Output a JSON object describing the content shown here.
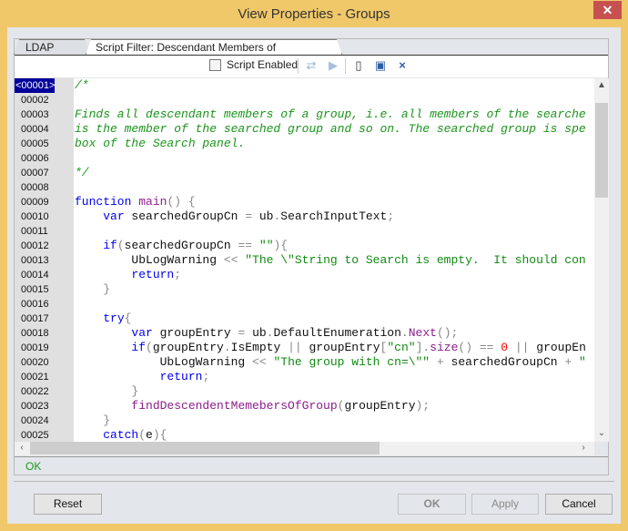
{
  "window": {
    "title": "View Properties - Groups",
    "close": "✕"
  },
  "tabs": [
    {
      "label": "LDAP Filter"
    },
    {
      "label": "Script Filter: Descendant Members of Group.script"
    }
  ],
  "toolbar": {
    "script_enabled_label": "Script Enabled",
    "script_enabled": false,
    "icons": [
      "refresh-icon",
      "run-icon",
      "new-document-icon",
      "save-icon",
      "close-icon"
    ]
  },
  "editor": {
    "current_line": "<00001>",
    "line_numbers": [
      "00002",
      "00003",
      "00004",
      "00005",
      "00006",
      "00007",
      "00008",
      "00009",
      "00010",
      "00011",
      "00012",
      "00013",
      "00014",
      "00015",
      "00016",
      "00017",
      "00018",
      "00019",
      "00020",
      "00021",
      "00022",
      "00023",
      "00024",
      "00025"
    ],
    "lines": [
      [
        [
          "c",
          "/*"
        ]
      ],
      [],
      [
        [
          "c",
          "Finds all descendant members of a group, i.e. all members of the searche"
        ]
      ],
      [
        [
          "c",
          "is the member of the searched group and so on. The searched group is spe"
        ]
      ],
      [
        [
          "c",
          "box of the Search panel."
        ]
      ],
      [],
      [
        [
          "c",
          "*/"
        ]
      ],
      [],
      [
        [
          "k",
          "function"
        ],
        [
          "t",
          " "
        ],
        [
          "f",
          "main"
        ],
        [
          "p",
          "() {"
        ]
      ],
      [
        [
          "t",
          "    "
        ],
        [
          "k",
          "var"
        ],
        [
          "t",
          " searchedGroupCn "
        ],
        [
          "p",
          "="
        ],
        [
          "t",
          " ub"
        ],
        [
          "p",
          "."
        ],
        [
          "t",
          "SearchInputText"
        ],
        [
          "p",
          ";"
        ]
      ],
      [],
      [
        [
          "t",
          "    "
        ],
        [
          "k",
          "if"
        ],
        [
          "p",
          "("
        ],
        [
          "t",
          "searchedGroupCn "
        ],
        [
          "p",
          "=="
        ],
        [
          "t",
          " "
        ],
        [
          "s",
          "\"\""
        ],
        [
          "p",
          "){"
        ]
      ],
      [
        [
          "t",
          "        UbLogWarning "
        ],
        [
          "p",
          "<<"
        ],
        [
          "t",
          " "
        ],
        [
          "s",
          "\"The \\\"String to Search is empty.  It should con"
        ]
      ],
      [
        [
          "t",
          "        "
        ],
        [
          "k",
          "return"
        ],
        [
          "p",
          ";"
        ]
      ],
      [
        [
          "t",
          "    "
        ],
        [
          "p",
          "}"
        ]
      ],
      [],
      [
        [
          "t",
          "    "
        ],
        [
          "k",
          "try"
        ],
        [
          "p",
          "{"
        ]
      ],
      [
        [
          "t",
          "        "
        ],
        [
          "k",
          "var"
        ],
        [
          "t",
          " groupEntry "
        ],
        [
          "p",
          "="
        ],
        [
          "t",
          " ub"
        ],
        [
          "p",
          "."
        ],
        [
          "t",
          "DefaultEnumeration"
        ],
        [
          "p",
          "."
        ],
        [
          "f",
          "Next"
        ],
        [
          "p",
          "();"
        ]
      ],
      [
        [
          "t",
          "        "
        ],
        [
          "k",
          "if"
        ],
        [
          "p",
          "("
        ],
        [
          "t",
          "groupEntry"
        ],
        [
          "p",
          "."
        ],
        [
          "t",
          "IsEmpty "
        ],
        [
          "p",
          "||"
        ],
        [
          "t",
          " groupEntry"
        ],
        [
          "p",
          "["
        ],
        [
          "s",
          "\"cn\""
        ],
        [
          "p",
          "]."
        ],
        [
          "f",
          "size"
        ],
        [
          "p",
          "()"
        ],
        [
          "t",
          " "
        ],
        [
          "p",
          "=="
        ],
        [
          "t",
          " "
        ],
        [
          "n",
          "0"
        ],
        [
          "t",
          " "
        ],
        [
          "p",
          "||"
        ],
        [
          "t",
          " groupEn"
        ]
      ],
      [
        [
          "t",
          "            UbLogWarning "
        ],
        [
          "p",
          "<<"
        ],
        [
          "t",
          " "
        ],
        [
          "s",
          "\"The group with cn=\\\"\""
        ],
        [
          "t",
          " "
        ],
        [
          "p",
          "+"
        ],
        [
          "t",
          " searchedGroupCn "
        ],
        [
          "p",
          "+"
        ],
        [
          "t",
          " "
        ],
        [
          "s",
          "\""
        ]
      ],
      [
        [
          "t",
          "            "
        ],
        [
          "k",
          "return"
        ],
        [
          "p",
          ";"
        ]
      ],
      [
        [
          "t",
          "        "
        ],
        [
          "p",
          "}"
        ]
      ],
      [
        [
          "t",
          "        "
        ],
        [
          "f",
          "findDescendentMemebersOfGroup"
        ],
        [
          "p",
          "("
        ],
        [
          "t",
          "groupEntry"
        ],
        [
          "p",
          ");"
        ]
      ],
      [
        [
          "t",
          "    "
        ],
        [
          "p",
          "}"
        ]
      ],
      [
        [
          "t",
          "    "
        ],
        [
          "k",
          "catch"
        ],
        [
          "p",
          "("
        ],
        [
          "t",
          "e"
        ],
        [
          "p",
          "){"
        ]
      ]
    ]
  },
  "status": {
    "text": "OK"
  },
  "buttons": {
    "reset": "Reset",
    "ok": "OK",
    "apply": "Apply",
    "cancel": "Cancel"
  },
  "colors": {
    "comment": "#1a951a",
    "keyword": "#0000f0",
    "function": "#8b1c8b",
    "string": "#118a11",
    "number": "#ff0000",
    "current_line_bg": "#00009c",
    "window_border": "#f0c86a",
    "close_button": "#c75050"
  }
}
